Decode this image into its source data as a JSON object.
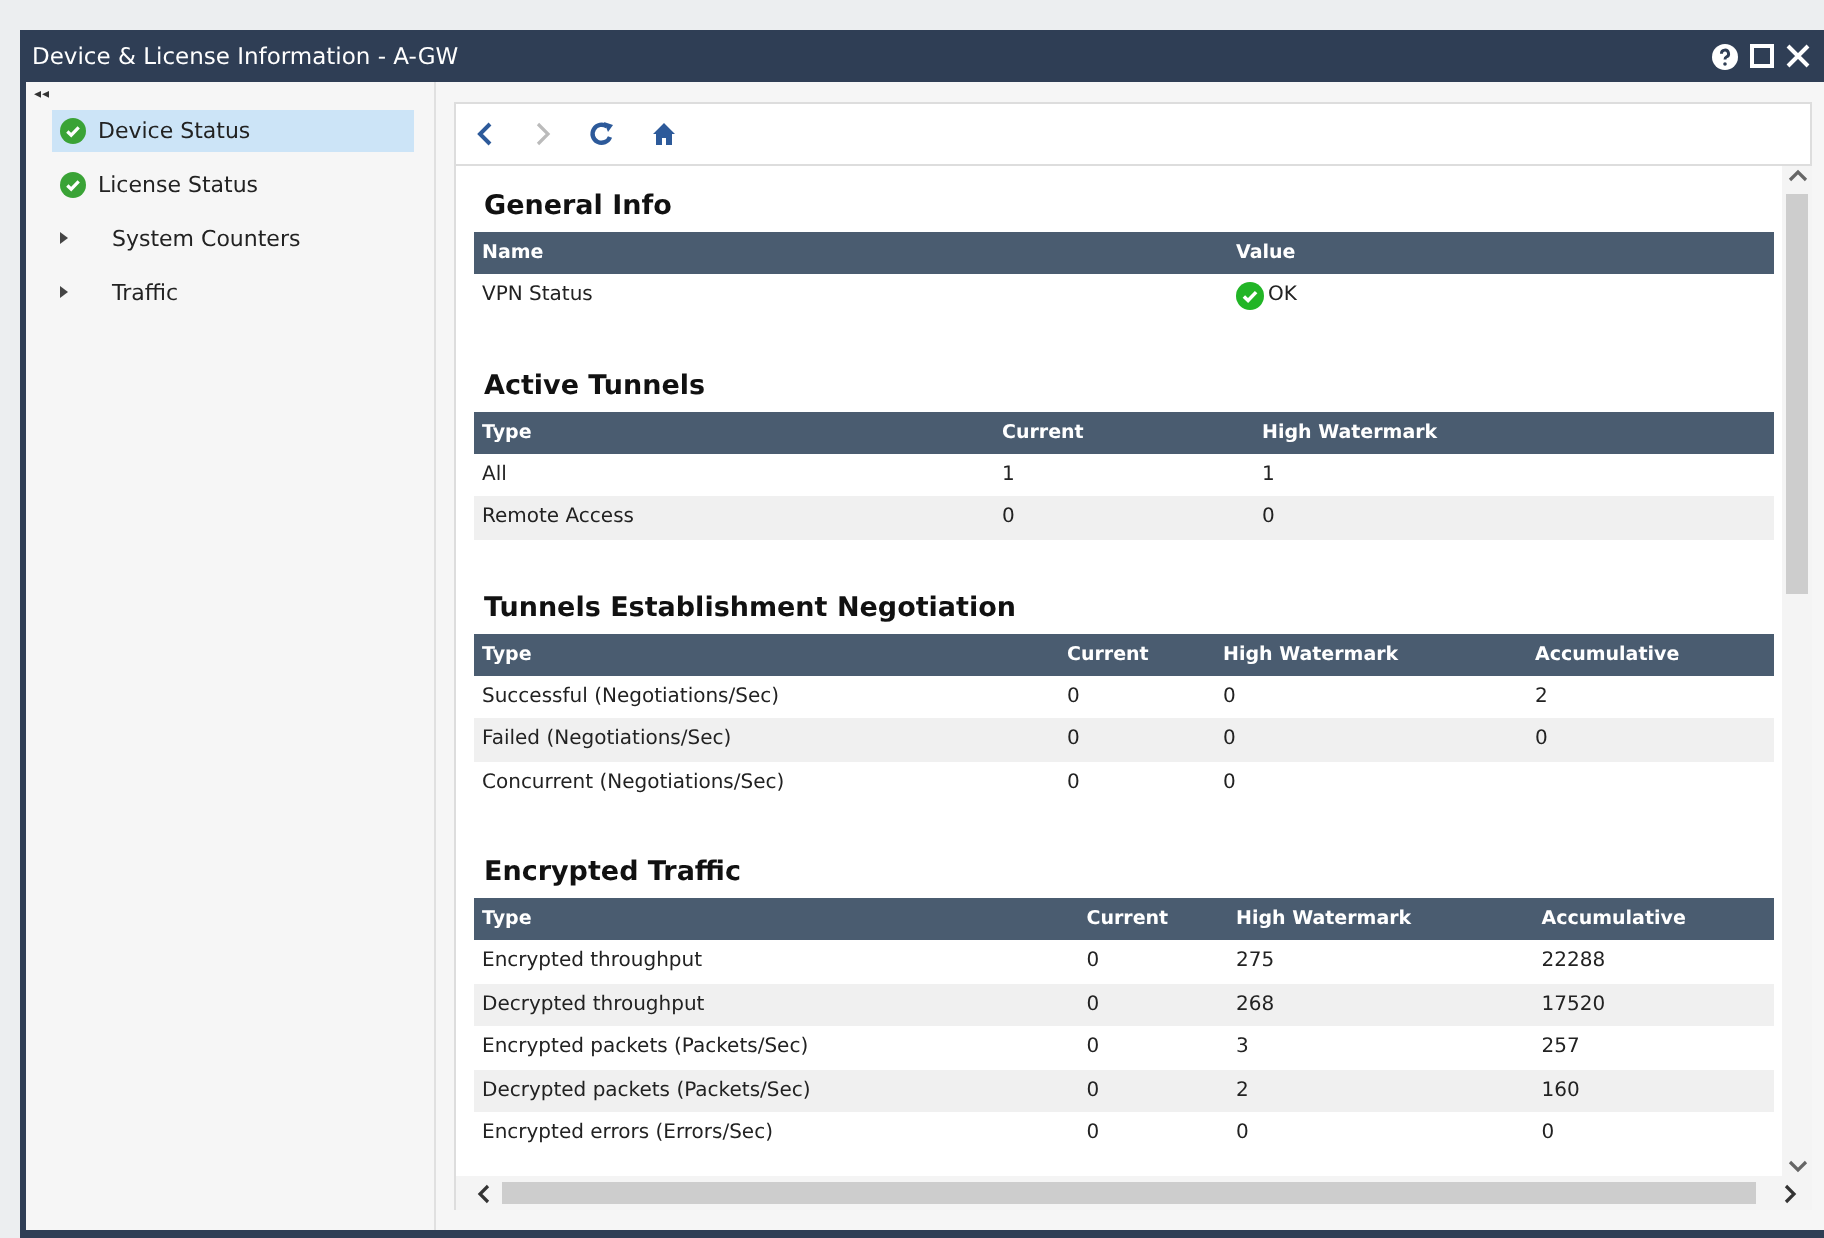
{
  "window": {
    "title": "Device & License Information - A-GW"
  },
  "sidebar": {
    "collapse_glyph": "◂◂",
    "items": [
      {
        "label": "Device Status",
        "kind": "status",
        "selected": true
      },
      {
        "label": "License Status",
        "kind": "status",
        "selected": false
      },
      {
        "label": "System Counters",
        "kind": "group",
        "selected": false
      },
      {
        "label": "Traffic",
        "kind": "group",
        "selected": false
      }
    ]
  },
  "sections": [
    {
      "title": "General Info",
      "columns": [
        "Name",
        "Value"
      ],
      "rows": [
        {
          "cells": [
            "VPN Status",
            "OK"
          ],
          "status_ok": true
        }
      ]
    },
    {
      "title": "Active Tunnels",
      "columns": [
        "Type",
        "Current",
        "High Watermark"
      ],
      "rows": [
        {
          "cells": [
            "All",
            "1",
            "1"
          ]
        },
        {
          "cells": [
            "Remote Access",
            "0",
            "0"
          ]
        }
      ]
    },
    {
      "title": "Tunnels Establishment Negotiation",
      "columns": [
        "Type",
        "Current",
        "High Watermark",
        "Accumulative"
      ],
      "rows": [
        {
          "cells": [
            "Successful (Negotiations/Sec)",
            "0",
            "0",
            "2"
          ]
        },
        {
          "cells": [
            "Failed (Negotiations/Sec)",
            "0",
            "0",
            "0"
          ]
        },
        {
          "cells": [
            "Concurrent (Negotiations/Sec)",
            "0",
            "0"
          ]
        }
      ]
    },
    {
      "title": "Encrypted Traffic",
      "columns": [
        "Type",
        "Current",
        "High Watermark",
        "Accumulative"
      ],
      "rows": [
        {
          "cells": [
            "Encrypted throughput",
            "0",
            "275",
            "22288"
          ]
        },
        {
          "cells": [
            "Decrypted throughput",
            "0",
            "268",
            "17520"
          ]
        },
        {
          "cells": [
            "Encrypted packets (Packets/Sec)",
            "0",
            "3",
            "257"
          ]
        },
        {
          "cells": [
            "Decrypted packets (Packets/Sec)",
            "0",
            "2",
            "160"
          ]
        },
        {
          "cells": [
            "Encrypted errors (Errors/Sec)",
            "0",
            "0",
            "0"
          ]
        }
      ]
    }
  ]
}
